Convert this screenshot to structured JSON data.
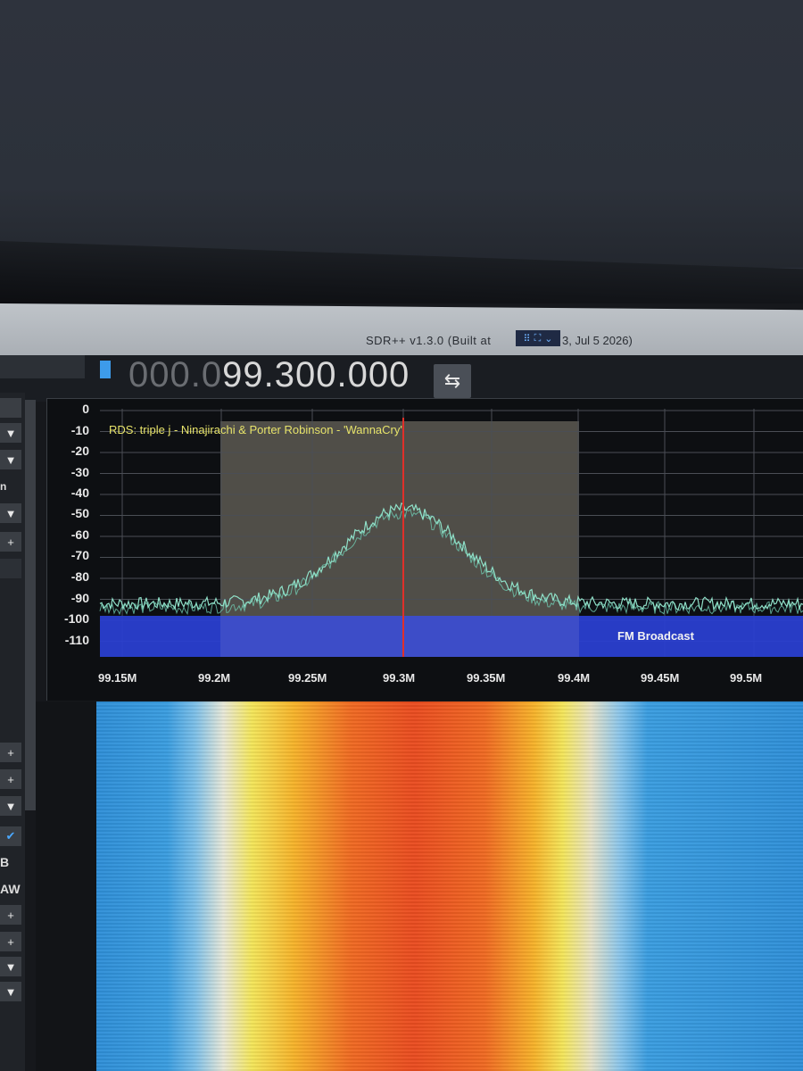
{
  "window": {
    "title_left": "SDR++ v1.3.0 (Built at",
    "title_right": "3, Jul  5 2026)"
  },
  "toolbar": {
    "frequency_dim": "000.0",
    "frequency_main": "99.300.000",
    "swap_icon": "swap-arrows-icon"
  },
  "fft": {
    "rds_text": "RDS: triple j - Ninajirachi & Porter Robinson - 'WannaCry'",
    "band_label": "FM Broadcast",
    "y_ticks": [
      "0",
      "-10",
      "-20",
      "-30",
      "-40",
      "-50",
      "-60",
      "-70",
      "-80",
      "-90",
      "-100",
      "-110"
    ],
    "x_ticks": [
      "99.15M",
      "99.2M",
      "99.25M",
      "99.3M",
      "99.35M",
      "99.4M",
      "99.45M",
      "99.5M"
    ]
  },
  "sidebar": {
    "text_b": "B",
    "text_aw": "AW",
    "text_n": "n"
  },
  "colors": {
    "accent": "#3d9bea",
    "trace": "#8fe0c8",
    "band": "#2a3fd0",
    "tuning_line": "#e0302a",
    "vfo_shade": "#cfc7b0"
  }
}
